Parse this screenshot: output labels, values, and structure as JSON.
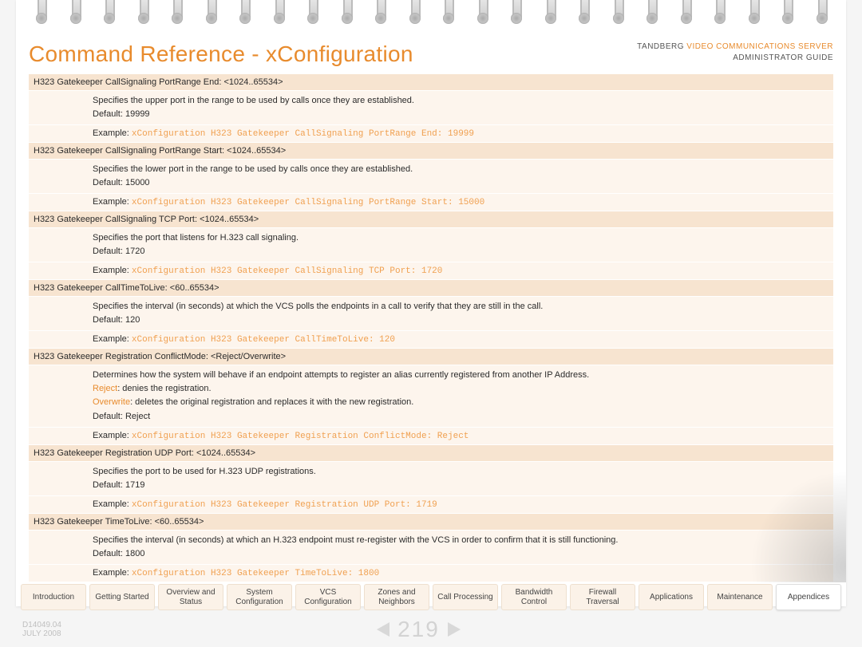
{
  "header": {
    "title": "Command Reference - xConfiguration",
    "brand_prefix": "TANDBERG ",
    "brand_product": "VIDEO COMMUNICATIONS SERVER",
    "brand_sub": "ADMINISTRATOR GUIDE"
  },
  "commands": [
    {
      "name": "H323 Gatekeeper CallSignaling PortRange End: <1024..65534>",
      "desc": "Specifies the upper port in the range to be used by calls once they are established.",
      "default": "Default: 19999",
      "example_label": "Example: ",
      "example_code": "xConfiguration H323 Gatekeeper CallSignaling PortRange End: 19999"
    },
    {
      "name": "H323 Gatekeeper CallSignaling PortRange Start: <1024..65534>",
      "desc": "Specifies the lower port in the range to be used by calls once they are established.",
      "default": "Default: 15000",
      "example_label": "Example: ",
      "example_code": "xConfiguration H323 Gatekeeper CallSignaling PortRange Start: 15000"
    },
    {
      "name": "H323 Gatekeeper CallSignaling TCP Port: <1024..65534>",
      "desc": "Specifies the port that listens for H.323 call signaling.",
      "default": "Default: 1720",
      "example_label": "Example: ",
      "example_code": "xConfiguration H323 Gatekeeper CallSignaling TCP Port: 1720"
    },
    {
      "name": "H323 Gatekeeper CallTimeToLive: <60..65534>",
      "desc": "Specifies the interval (in seconds) at which the VCS polls the endpoints in a call to verify that they are still in the call.",
      "default": "Default: 120",
      "example_label": "Example: ",
      "example_code": "xConfiguration H323 Gatekeeper CallTimeToLive: 120"
    },
    {
      "name": "H323 Gatekeeper Registration ConflictMode: <Reject/Overwrite>",
      "desc": "Determines how the system will behave if an endpoint attempts to register an alias currently registered from another IP Address.",
      "reject_kw": "Reject",
      "reject_txt": ": denies the registration.",
      "overwrite_kw": "Overwrite",
      "overwrite_txt": ": deletes the original registration and replaces it with the new registration.",
      "default": "Default: Reject",
      "example_label": "Example: ",
      "example_code": "xConfiguration H323 Gatekeeper Registration ConflictMode: Reject"
    },
    {
      "name": "H323 Gatekeeper Registration UDP Port: <1024..65534>",
      "desc": "Specifies the port to be used for H.323 UDP registrations.",
      "default": "Default: 1719",
      "example_label": "Example: ",
      "example_code": "xConfiguration H323 Gatekeeper Registration UDP Port: 1719"
    },
    {
      "name": "H323 Gatekeeper TimeToLive: <60..65534>",
      "desc": "Specifies the interval (in seconds) at which an H.323 endpoint must re-register with the VCS in order to confirm that it is still functioning.",
      "default": "Default: 1800",
      "example_label": "Example: ",
      "example_code": "xConfiguration H323 Gatekeeper TimeToLive: 1800"
    }
  ],
  "nav": {
    "tabs": [
      "Introduction",
      "Getting Started",
      "Overview and Status",
      "System Configuration",
      "VCS Configuration",
      "Zones and Neighbors",
      "Call Processing",
      "Bandwidth Control",
      "Firewall Traversal",
      "Applications",
      "Maintenance",
      "Appendices"
    ],
    "active_index": 11
  },
  "footer": {
    "doc_id": "D14049.04",
    "date": "JULY 2008",
    "page": "219"
  }
}
